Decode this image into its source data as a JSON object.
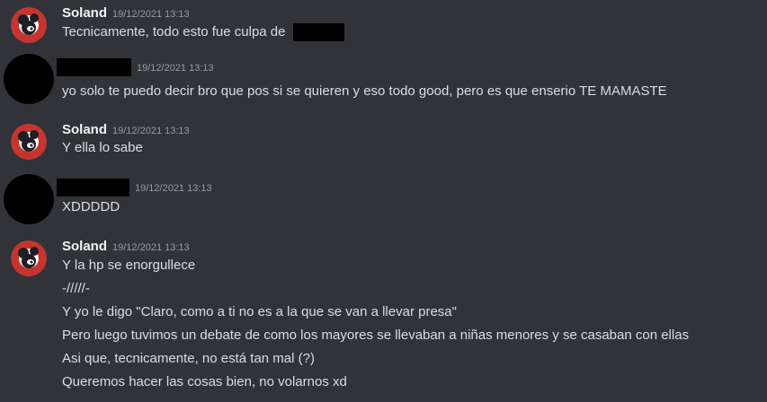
{
  "messages": [
    {
      "author": "Soland",
      "timestamp": "19/12/2021 13:13",
      "lines": [
        "Tecnicamente, todo esto fue culpa de"
      ]
    },
    {
      "author": "",
      "timestamp": "19/12/2021 13:13",
      "lines": [
        "yo solo te puedo decir bro que pos si se quieren y eso todo good, pero es que enserio TE MAMASTE"
      ]
    },
    {
      "author": "Soland",
      "timestamp": "19/12/2021 13:13",
      "lines": [
        "Y ella lo sabe"
      ]
    },
    {
      "author": "",
      "timestamp": "19/12/2021 13:13",
      "lines": [
        "XDDDDD"
      ]
    },
    {
      "author": "Soland",
      "timestamp": "19/12/2021 13:13",
      "lines": [
        "Y la hp se enorgullece",
        "-/////-",
        "Y yo le digo \"Claro, como a ti no es a la que se van a llevar presa\"",
        "Pero luego tuvimos un debate de como los mayores se llevaban a niñas menores y se casaban con ellas",
        "Asi que, tecnicamente, no está tan mal (?)",
        "Queremos hacer las cosas bien, no volarnos xd"
      ]
    }
  ],
  "colors": {
    "background": "#313338",
    "text": "#dbdee1",
    "username": "#f2f3f5",
    "timestamp": "#949ba4",
    "redaction": "#000000",
    "avatar_red": "#c5352f"
  },
  "icons": {
    "soland_avatar": "cartoon-mouse-avatar-icon",
    "redacted_avatar": "blacked-out-avatar"
  }
}
